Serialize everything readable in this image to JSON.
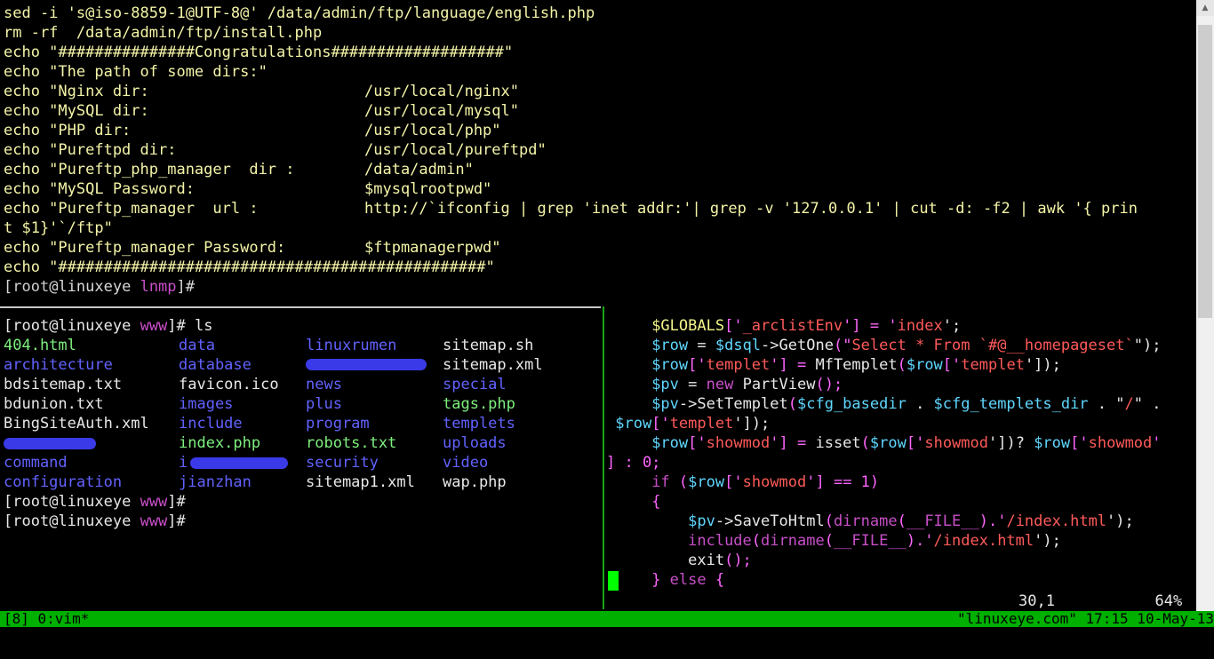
{
  "top_pane": {
    "lines": [
      {
        "a": "sed -i 's@iso-8859-1@UTF-8@' /data/admin/ftp/language/english.php",
        "b": ""
      },
      {
        "a": "rm -rf  /data/admin/ftp/install.php",
        "b": ""
      },
      {
        "a": "echo \"###############Congratulations###################\"",
        "b": ""
      },
      {
        "a": "echo \"The path of some dirs:\"",
        "b": ""
      },
      {
        "a": "echo \"Nginx dir:",
        "b": "/usr/local/nginx\""
      },
      {
        "a": "echo \"MySQL dir:",
        "b": "/usr/local/mysql\""
      },
      {
        "a": "echo \"PHP dir:",
        "b": "/usr/local/php\""
      },
      {
        "a": "echo \"Pureftpd dir:",
        "b": "/usr/local/pureftpd\""
      },
      {
        "a": "echo \"Pureftp_php_manager  dir :",
        "b": "/data/admin\""
      },
      {
        "a": "echo \"MySQL Password:",
        "b": "$mysqlrootpwd\""
      },
      {
        "a": "echo \"Pureftp_manager  url :",
        "b": "http://`ifconfig | grep 'inet addr:'| grep -v '127.0.0.1' | cut -d: -f2 | awk '{ prin"
      },
      {
        "a": "t $1}'`/ftp\"",
        "b": ""
      },
      {
        "a": "echo \"Pureftp_manager Password:",
        "b": "$ftpmanagerpwd\""
      },
      {
        "a": "echo \"###############################################\"",
        "b": ""
      }
    ],
    "prompt": {
      "open": "[",
      "user": "root",
      "at": "@linuxeye",
      "dir": "lnmp",
      "close": "]#"
    }
  },
  "left_pane": {
    "prompt1": {
      "open": "[",
      "user": "root",
      "at": "@linuxeye",
      "dir": "www",
      "close": "]#",
      "cmd": " ls"
    },
    "rows": [
      [
        {
          "t": "404.html",
          "c": "c-green"
        },
        {
          "t": "data",
          "c": "c-blue"
        },
        {
          "t": "linuxrumen",
          "c": "c-blue"
        },
        {
          "t": "sitemap.sh",
          "c": "c-white"
        }
      ],
      [
        {
          "t": "architecture",
          "c": "c-blue"
        },
        {
          "t": "database",
          "c": "c-blue"
        },
        {
          "t": "",
          "c": "c-blue"
        },
        {
          "t": "sitemap.xml",
          "c": "c-white"
        }
      ],
      [
        {
          "t": "bdsitemap.txt",
          "c": "c-white"
        },
        {
          "t": "favicon.ico",
          "c": "c-white"
        },
        {
          "t": "news",
          "c": "c-blue"
        },
        {
          "t": "special",
          "c": "c-blue"
        }
      ],
      [
        {
          "t": "bdunion.txt",
          "c": "c-white"
        },
        {
          "t": "images",
          "c": "c-blue"
        },
        {
          "t": "plus",
          "c": "c-blue"
        },
        {
          "t": "tags.php",
          "c": "c-green"
        }
      ],
      [
        {
          "t": "BingSiteAuth.xml",
          "c": "c-white"
        },
        {
          "t": "include",
          "c": "c-blue"
        },
        {
          "t": "program",
          "c": "c-blue"
        },
        {
          "t": "templets",
          "c": "c-blue"
        }
      ],
      [
        {
          "t": "",
          "c": "c-blue"
        },
        {
          "t": "index.php",
          "c": "c-green"
        },
        {
          "t": "robots.txt",
          "c": "c-green"
        },
        {
          "t": "uploads",
          "c": "c-blue"
        }
      ],
      [
        {
          "t": "command",
          "c": "c-blue"
        },
        {
          "t": "i",
          "c": "c-blue"
        },
        {
          "t": "security",
          "c": "c-blue"
        },
        {
          "t": "video",
          "c": "c-blue"
        }
      ],
      [
        {
          "t": "configuration",
          "c": "c-blue"
        },
        {
          "t": "jianzhan",
          "c": "c-blue"
        },
        {
          "t": "sitemap1.xml",
          "c": "c-white"
        },
        {
          "t": "wap.php",
          "c": "c-white"
        }
      ]
    ],
    "prompt2": {
      "open": "[",
      "user": "root",
      "at": "@linuxeye",
      "dir": "www",
      "close": "]#"
    },
    "prompt3": {
      "open": "[",
      "user": "root",
      "at": "@linuxeye",
      "dir": "www",
      "close": "]#"
    }
  },
  "right_pane": {
    "lines": [
      [
        {
          "t": "     ",
          "c": "o"
        },
        {
          "t": "$GLOBALS",
          "c": "v2"
        },
        {
          "t": "['",
          "c": "g"
        },
        {
          "t": "_arclistEnv",
          "c": "s"
        },
        {
          "t": "'] = '",
          "c": "g"
        },
        {
          "t": "index",
          "c": "s"
        },
        {
          "t": "';",
          "c": "o"
        }
      ],
      [
        {
          "t": "     ",
          "c": "o"
        },
        {
          "t": "$row",
          "c": "v"
        },
        {
          "t": " = ",
          "c": "o"
        },
        {
          "t": "$dsql",
          "c": "v"
        },
        {
          "t": "->",
          "c": "o"
        },
        {
          "t": "GetOne",
          "c": "o"
        },
        {
          "t": "(\"",
          "c": "g"
        },
        {
          "t": "Select * From `#@__homepageset`",
          "c": "s"
        },
        {
          "t": "\");",
          "c": "o"
        }
      ],
      [
        {
          "t": "     ",
          "c": "o"
        },
        {
          "t": "$row",
          "c": "v"
        },
        {
          "t": "['",
          "c": "g"
        },
        {
          "t": "templet",
          "c": "s"
        },
        {
          "t": "'] = ",
          "c": "g"
        },
        {
          "t": "MfTemplet",
          "c": "o"
        },
        {
          "t": "(",
          "c": "g"
        },
        {
          "t": "$row",
          "c": "v"
        },
        {
          "t": "['",
          "c": "g"
        },
        {
          "t": "templet",
          "c": "s"
        },
        {
          "t": "']);",
          "c": "o"
        }
      ],
      [
        {
          "t": "     ",
          "c": "o"
        },
        {
          "t": "$pv",
          "c": "v"
        },
        {
          "t": " = ",
          "c": "o"
        },
        {
          "t": "new",
          "c": "k"
        },
        {
          "t": " PartView",
          "c": "o"
        },
        {
          "t": "();",
          "c": "g"
        }
      ],
      [
        {
          "t": "     ",
          "c": "o"
        },
        {
          "t": "$pv",
          "c": "v"
        },
        {
          "t": "->",
          "c": "o"
        },
        {
          "t": "SetTemplet",
          "c": "o"
        },
        {
          "t": "(",
          "c": "g"
        },
        {
          "t": "$cfg_basedir",
          "c": "v"
        },
        {
          "t": " . ",
          "c": "o"
        },
        {
          "t": "$cfg_templets_dir",
          "c": "v"
        },
        {
          "t": " . \"",
          "c": "o"
        },
        {
          "t": "/",
          "c": "s"
        },
        {
          "t": "\" .",
          "c": "o"
        }
      ],
      [
        {
          "t": " ",
          "c": "o"
        },
        {
          "t": "$row",
          "c": "v"
        },
        {
          "t": "['",
          "c": "g"
        },
        {
          "t": "templet",
          "c": "s"
        },
        {
          "t": "']);",
          "c": "o"
        }
      ],
      [
        {
          "t": "     ",
          "c": "o"
        },
        {
          "t": "$row",
          "c": "v"
        },
        {
          "t": "['",
          "c": "g"
        },
        {
          "t": "showmod",
          "c": "s"
        },
        {
          "t": "'] = ",
          "c": "g"
        },
        {
          "t": "isset",
          "c": "o"
        },
        {
          "t": "(",
          "c": "g"
        },
        {
          "t": "$row",
          "c": "v"
        },
        {
          "t": "['",
          "c": "g"
        },
        {
          "t": "showmod",
          "c": "s"
        },
        {
          "t": "'])? ",
          "c": "o"
        },
        {
          "t": "$row",
          "c": "v"
        },
        {
          "t": "['",
          "c": "g"
        },
        {
          "t": "showmod",
          "c": "s"
        },
        {
          "t": "'",
          "c": "g"
        }
      ],
      [
        {
          "t": "] : 0;",
          "c": "g"
        }
      ],
      [
        {
          "t": "     ",
          "c": "o"
        },
        {
          "t": "if",
          "c": "k"
        },
        {
          "t": " (",
          "c": "g"
        },
        {
          "t": "$row",
          "c": "v"
        },
        {
          "t": "['",
          "c": "g"
        },
        {
          "t": "showmod",
          "c": "s"
        },
        {
          "t": "'] == 1)",
          "c": "g"
        }
      ],
      [
        {
          "t": "     ",
          "c": "o"
        },
        {
          "t": "{",
          "c": "g"
        }
      ],
      [
        {
          "t": "         ",
          "c": "o"
        },
        {
          "t": "$pv",
          "c": "v"
        },
        {
          "t": "->",
          "c": "o"
        },
        {
          "t": "SaveToHtml",
          "c": "o"
        },
        {
          "t": "(",
          "c": "g"
        },
        {
          "t": "dirname",
          "c": "k"
        },
        {
          "t": "(",
          "c": "g"
        },
        {
          "t": "__FILE__",
          "c": "k"
        },
        {
          "t": ").'",
          "c": "g"
        },
        {
          "t": "/index.html",
          "c": "s"
        },
        {
          "t": "');",
          "c": "o"
        }
      ],
      [
        {
          "t": "         ",
          "c": "o"
        },
        {
          "t": "include",
          "c": "k"
        },
        {
          "t": "(",
          "c": "g"
        },
        {
          "t": "dirname",
          "c": "k"
        },
        {
          "t": "(",
          "c": "g"
        },
        {
          "t": "__FILE__",
          "c": "k"
        },
        {
          "t": ").'",
          "c": "g"
        },
        {
          "t": "/index.html",
          "c": "s"
        },
        {
          "t": "');",
          "c": "o"
        }
      ],
      [
        {
          "t": "         ",
          "c": "o"
        },
        {
          "t": "exit",
          "c": "o"
        },
        {
          "t": "();",
          "c": "g"
        }
      ],
      [
        {
          "t": "     ",
          "c": "o"
        },
        {
          "t": "}",
          "c": "g"
        },
        {
          "t": " else ",
          "c": "k"
        },
        {
          "t": "{",
          "c": "g"
        }
      ]
    ],
    "ruler": "30,1           64%"
  },
  "status_bar": {
    "left": "[8] 0:vim*",
    "right": "\"linuxeye.com\" 17:15 10-May-13"
  }
}
